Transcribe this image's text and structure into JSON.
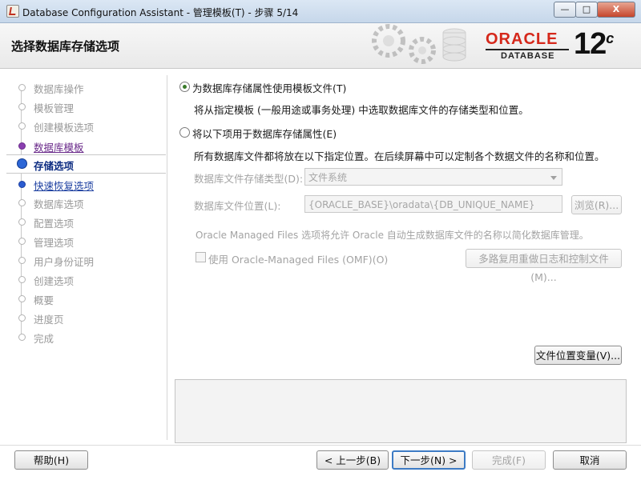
{
  "window": {
    "title": "Database Configuration Assistant - 管理模板(T) - 步骤 5/14",
    "minimize": "—",
    "maximize": "□",
    "close": "X"
  },
  "header": {
    "page_title": "选择数据库存储选项",
    "logo_oracle": "ORACLE",
    "logo_database": "DATABASE",
    "logo_version": "12",
    "logo_version_suffix": "c"
  },
  "nav": {
    "items": [
      {
        "label": "数据库操作",
        "state": "done"
      },
      {
        "label": "模板管理",
        "state": "done"
      },
      {
        "label": "创建模板选项",
        "state": "done"
      },
      {
        "label": "数据库模板",
        "state": "visited"
      },
      {
        "label": "存储选项",
        "state": "current"
      },
      {
        "label": "快速恢复选项",
        "state": "link"
      },
      {
        "label": "数据库选项",
        "state": "pending"
      },
      {
        "label": "配置选项",
        "state": "pending"
      },
      {
        "label": "管理选项",
        "state": "pending"
      },
      {
        "label": "用户身份证明",
        "state": "pending"
      },
      {
        "label": "创建选项",
        "state": "pending"
      },
      {
        "label": "概要",
        "state": "pending"
      },
      {
        "label": "进度页",
        "state": "pending"
      },
      {
        "label": "完成",
        "state": "pending"
      }
    ]
  },
  "main": {
    "option_template": {
      "label": "为数据库存储属性使用模板文件(T)",
      "selected": true,
      "description": "将从指定模板 (一般用途或事务处理) 中选取数据库文件的存储类型和位置。"
    },
    "option_custom": {
      "label": "将以下项用于数据库存储属性(E)",
      "selected": false,
      "description": "所有数据库文件都将放在以下指定位置。在后续屏幕中可以定制各个数据文件的名称和位置。"
    },
    "storage_type_label": "数据库文件存储类型(D):",
    "storage_type_value": "文件系统",
    "file_location_label": "数据库文件位置(L):",
    "file_location_value": "{ORACLE_BASE}\\oradata\\{DB_UNIQUE_NAME}",
    "browse_button": "浏览(R)...",
    "omf_note": "Oracle Managed Files 选项将允许 Oracle 自动生成数据库文件的名称以简化数据库管理。",
    "omf_checkbox_label": "使用 Oracle-Managed Files (OMF)(O)",
    "multiplex_button": "多路复用重做日志和控制文件(M)...",
    "file_location_vars_button": "文件位置变量(V)..."
  },
  "footer": {
    "help": "帮助(H)",
    "back": "< 上一步(B)",
    "next": "下一步(N) >",
    "finish": "完成(F)",
    "cancel": "取消"
  }
}
